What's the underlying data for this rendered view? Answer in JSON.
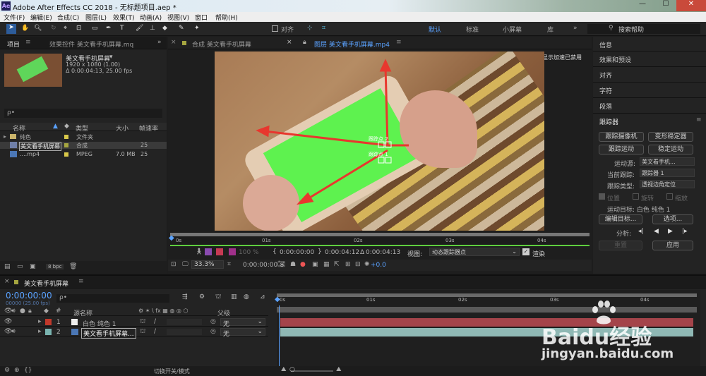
{
  "app": {
    "title": "Adobe After Effects CC 2018 - 无标题项目.aep *"
  },
  "menu": [
    "文件(F)",
    "编辑(E)",
    "合成(C)",
    "图层(L)",
    "效果(T)",
    "动画(A)",
    "视图(V)",
    "窗口",
    "帮助(H)"
  ],
  "toolbar": {
    "snap_label": "对齐",
    "workspaces": [
      "默认",
      "标准",
      "小屏幕",
      "库"
    ],
    "search_placeholder": "搜索帮助"
  },
  "project": {
    "tab": "项目",
    "effects_tab": "效果控件 美文看手机屏幕.mq",
    "item_name": "美文看手机屏幕",
    "item_res": "1920 x 1080 (1.00)",
    "item_dur": "Δ 0:00:04:13, 25.00 fps",
    "columns": [
      "名称",
      "类型",
      "大小",
      "帧速率"
    ],
    "rows": [
      {
        "name": "纯色",
        "type": "文件夹",
        "size": "",
        "fps": ""
      },
      {
        "name": "美文看手机屏幕",
        "type": "合成",
        "size": "",
        "fps": "25"
      },
      {
        "name": "....mp4",
        "type": "MPEG",
        "size": "7.0 MB",
        "fps": "25"
      }
    ],
    "bpc": "8 bpc"
  },
  "viewer": {
    "comp_tab": "合成 美文看手机屏幕",
    "layer_tab": "图层 美文看手机屏幕.mp4",
    "render_note": "显示加速已禁用",
    "track_label_1": "跟踪点 1",
    "track_label_2": "跟踪点 2",
    "ruler": [
      "0s",
      "01s",
      "02s",
      "03s",
      "04s"
    ],
    "pct": "100 %",
    "in_time": "0:00:00:00",
    "out_time": "0:00:04:12",
    "dur_time": "0:00:04:13",
    "view_label": "视图:",
    "view_value": "动态跟踪器点",
    "render_label": "渲染",
    "zoom": "33.3%",
    "timecode": "0:00:00:00",
    "exposure": "+0.0"
  },
  "right": {
    "panels": [
      "信息",
      "效果和预设",
      "对齐",
      "字符",
      "段落"
    ],
    "tracker_title": "跟踪器",
    "buttons": [
      "跟踪摄像机",
      "变形稳定器",
      "跟踪运动",
      "稳定运动"
    ],
    "motion_source_label": "运动源:",
    "motion_source": "美文看手机...",
    "current_track_label": "当前跟踪:",
    "current_track": "跟踪器 1",
    "track_type_label": "跟踪类型:",
    "track_type": "透视边角定位",
    "checks": [
      "位置",
      "旋转",
      "缩放"
    ],
    "target": "运动目标: 白色 纯色 1",
    "edit_target": "编辑目标...",
    "options": "选项...",
    "analyze": "分析:",
    "reset": "重置",
    "apply": "应用"
  },
  "timeline": {
    "tab": "美文看手机屏幕",
    "timecode": "0:00:00:00",
    "timecode_sub": "00000 (25.00 fps)",
    "search_placeholder": "ρ•",
    "col_source": "源名称",
    "col_parent": "父级",
    "layers": [
      {
        "num": "1",
        "name": "白色 纯色 1",
        "parent": "无",
        "color": "#c0392b"
      },
      {
        "num": "2",
        "name": "美文看手机屏幕...",
        "parent": "无",
        "color": "#7ab4b0"
      }
    ],
    "ruler": [
      "0s",
      "01s",
      "02s",
      "03s",
      "04s"
    ],
    "footer": "切换开关/模式"
  },
  "watermark": {
    "brand": "Baidu经验",
    "url": "jingyan.baidu.com"
  }
}
